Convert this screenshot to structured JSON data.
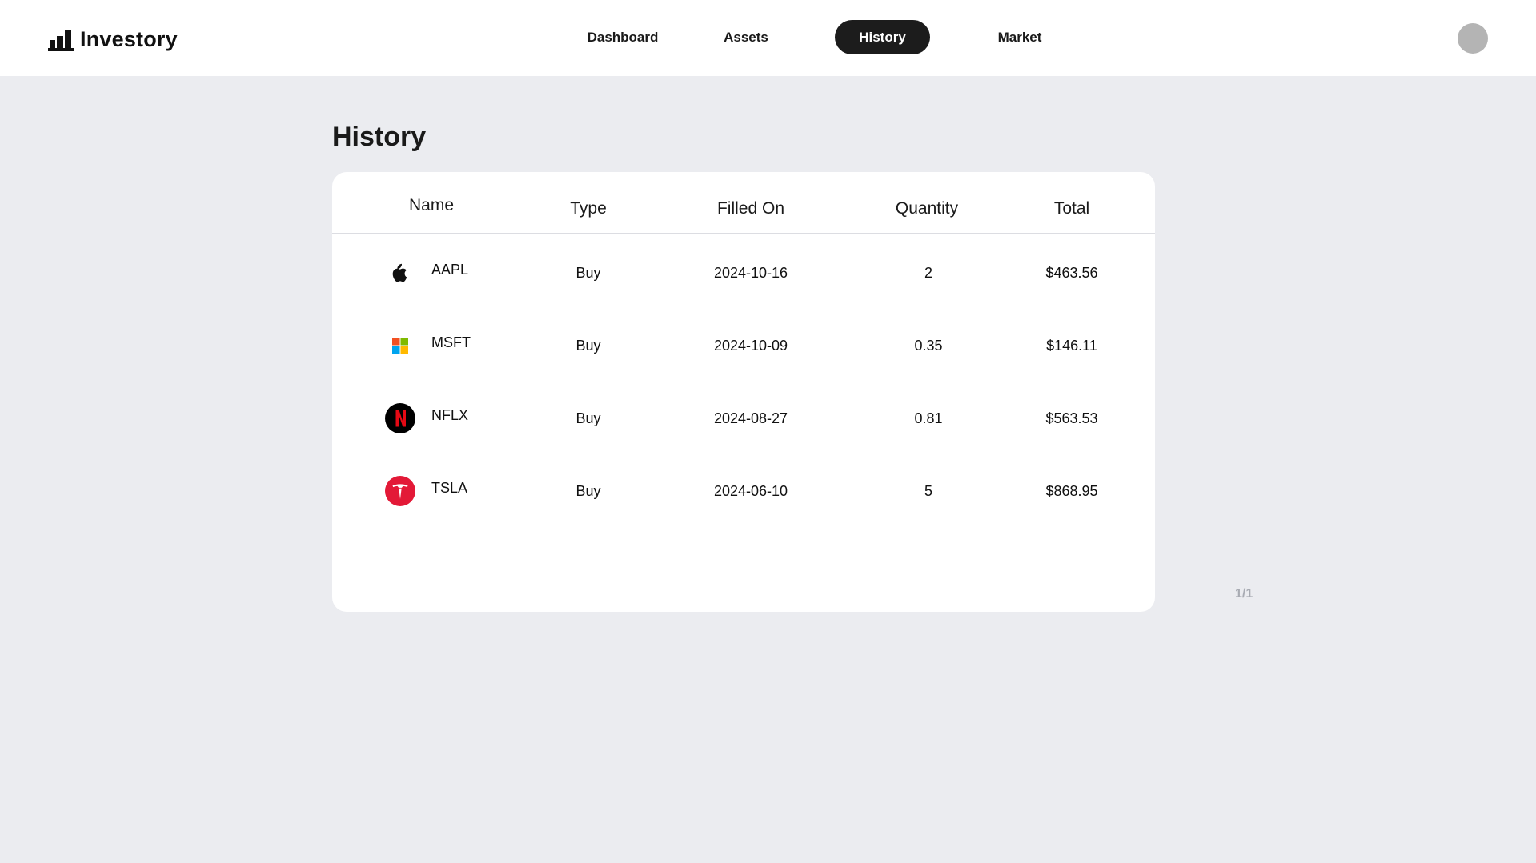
{
  "brand": {
    "name": "Investory"
  },
  "nav": {
    "items": [
      {
        "label": "Dashboard",
        "active": false
      },
      {
        "label": "Assets",
        "active": false
      },
      {
        "label": "History",
        "active": true
      },
      {
        "label": "Market",
        "active": false
      }
    ]
  },
  "user": {
    "avatar_color": "#b4b4b4"
  },
  "page": {
    "title": "History"
  },
  "table": {
    "columns": [
      "Name",
      "Type",
      "Filled On",
      "Quantity",
      "Total"
    ],
    "rows": [
      {
        "ticker": "AAPL",
        "icon": "apple-logo-icon",
        "type": "Buy",
        "filled_on": "2024-10-16",
        "quantity": "2",
        "total": "$463.56"
      },
      {
        "ticker": "MSFT",
        "icon": "microsoft-logo-icon",
        "type": "Buy",
        "filled_on": "2024-10-09",
        "quantity": "0.35",
        "total": "$146.11"
      },
      {
        "ticker": "NFLX",
        "icon": "netflix-logo-icon",
        "type": "Buy",
        "filled_on": "2024-08-27",
        "quantity": "0.81",
        "total": "$563.53"
      },
      {
        "ticker": "TSLA",
        "icon": "tesla-logo-icon",
        "type": "Buy",
        "filled_on": "2024-06-10",
        "quantity": "5",
        "total": "$868.95"
      }
    ]
  },
  "pagination": {
    "label": "1/1"
  },
  "colors": {
    "background": "#ebecf0",
    "active_nav": "#1c1c1c",
    "netflix_red": "#e50914",
    "tesla_red": "#e31937"
  }
}
